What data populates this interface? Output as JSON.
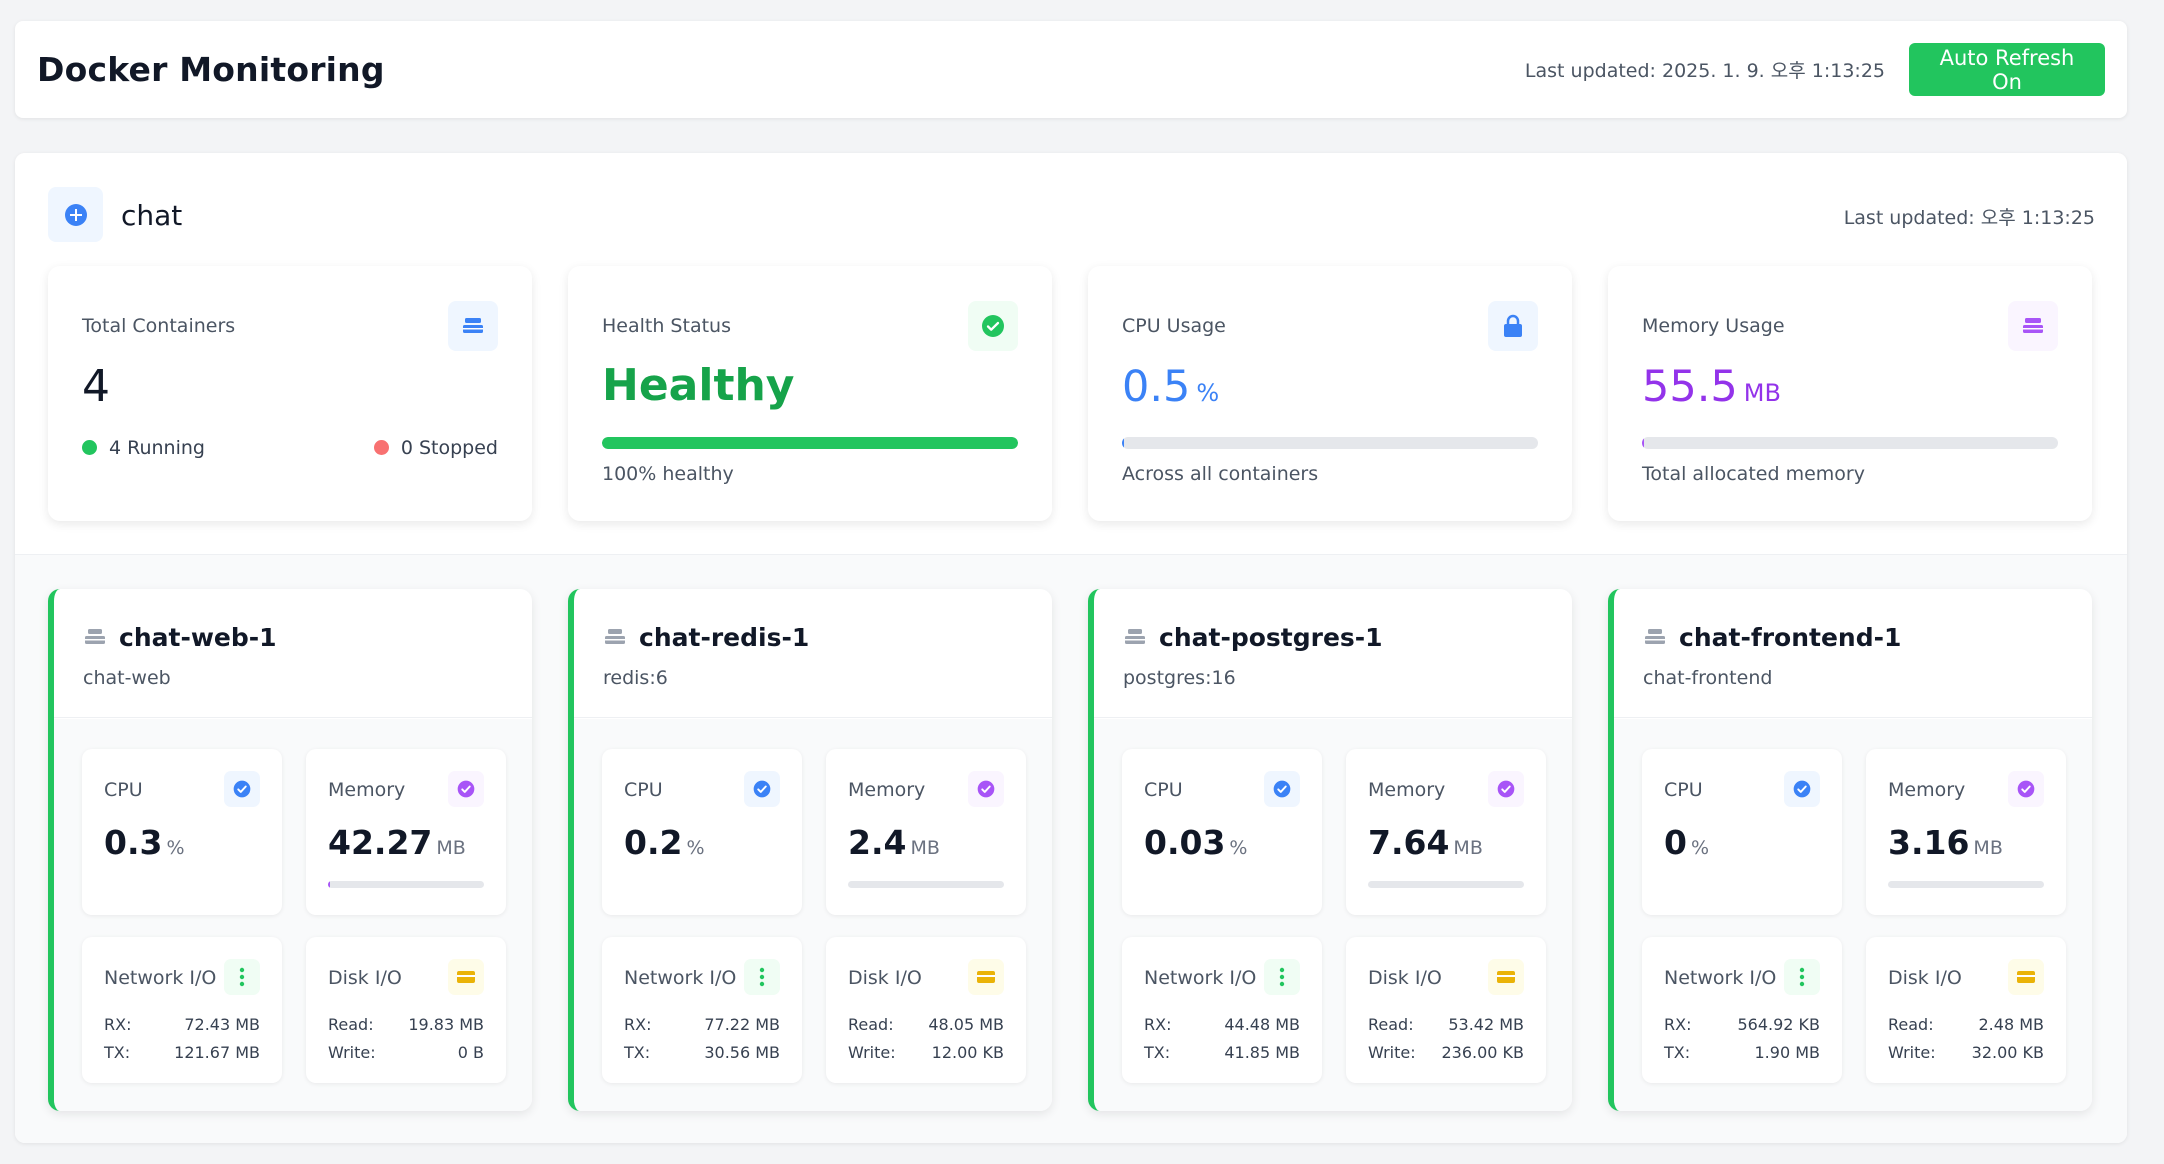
{
  "header": {
    "title": "Docker Monitoring",
    "last_updated": "Last updated: 2025. 1. 9. 오후 1:13:25",
    "auto_refresh_label": "Auto Refresh On"
  },
  "project": {
    "name": "chat",
    "last_updated": "Last updated: 오후 1:13:25",
    "summary": {
      "total": {
        "label": "Total Containers",
        "value": "4",
        "running": "4 Running",
        "stopped": "0 Stopped"
      },
      "health": {
        "label": "Health Status",
        "value": "Healthy",
        "sub": "100% healthy",
        "percent": 100
      },
      "cpu": {
        "label": "CPU Usage",
        "value": "0.5",
        "unit": "%",
        "sub": "Across all containers",
        "percent": 0.5
      },
      "memory": {
        "label": "Memory Usage",
        "value": "55.5",
        "unit": "MB",
        "sub": "Total allocated memory",
        "percent": 0.6
      }
    },
    "containers": [
      {
        "name": "chat-web-1",
        "image": "chat-web",
        "cpu": "0.3",
        "mem": "42.27",
        "mem_percent": 1.2,
        "rx": "72.43 MB",
        "tx": "121.67 MB",
        "read": "19.83 MB",
        "write": "0 B"
      },
      {
        "name": "chat-redis-1",
        "image": "redis:6",
        "cpu": "0.2",
        "mem": "2.4",
        "mem_percent": 0,
        "rx": "77.22 MB",
        "tx": "30.56 MB",
        "read": "48.05 MB",
        "write": "12.00 KB"
      },
      {
        "name": "chat-postgres-1",
        "image": "postgres:16",
        "cpu": "0.03",
        "mem": "7.64",
        "mem_percent": 0,
        "rx": "44.48 MB",
        "tx": "41.85 MB",
        "read": "53.42 MB",
        "write": "236.00 KB"
      },
      {
        "name": "chat-frontend-1",
        "image": "chat-frontend",
        "cpu": "0",
        "mem": "3.16",
        "mem_percent": 0,
        "rx": "564.92 KB",
        "tx": "1.90 MB",
        "read": "2.48 MB",
        "write": "32.00 KB"
      }
    ],
    "labels": {
      "cpu": "CPU",
      "memory": "Memory",
      "cpu_unit": "%",
      "mem_unit": "MB",
      "network": "Network I/O",
      "disk": "Disk I/O",
      "rx": "RX:",
      "tx": "TX:",
      "read": "Read:",
      "write": "Write:"
    }
  },
  "colors": {
    "green": "#22c55e",
    "blue": "#3b82f6",
    "purple": "#a855f7",
    "yellow": "#eab308",
    "red": "#f87171"
  },
  "icons": {
    "project": "plus-circle-icon",
    "containers": "stack-icon",
    "health": "check-circle-icon",
    "cpu": "lock-icon",
    "memory": "stack-icon",
    "network": "vertical-dots-icon",
    "disk": "card-icon"
  }
}
